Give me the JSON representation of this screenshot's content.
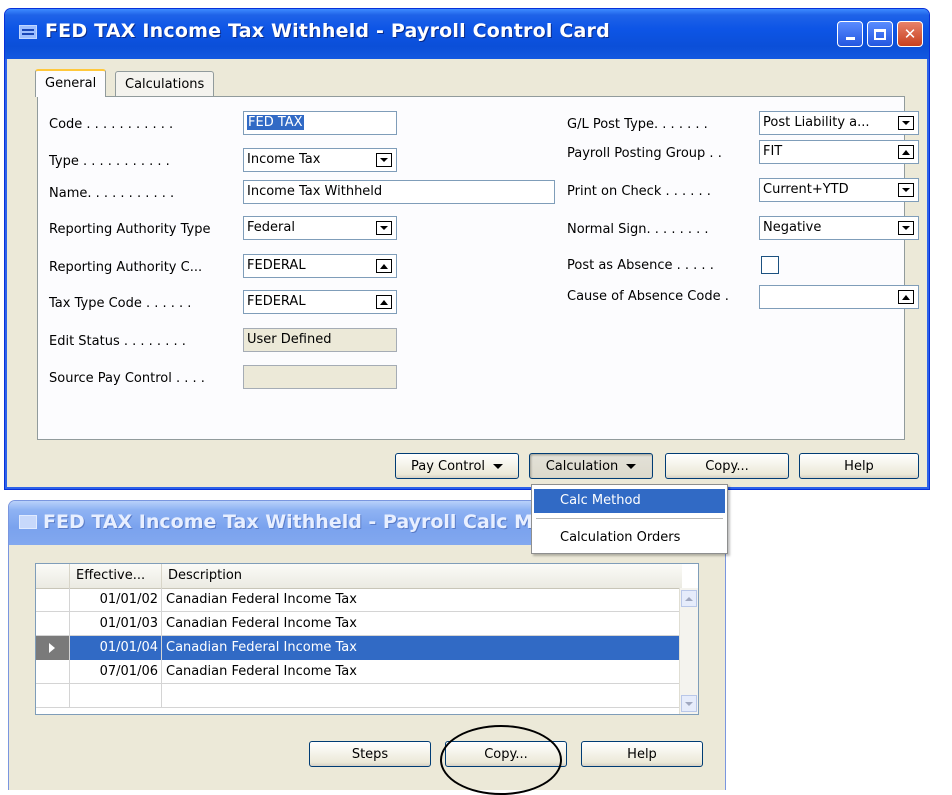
{
  "main_window": {
    "title": "FED TAX Income Tax Withheld - Payroll Control Card",
    "tabs": [
      {
        "label": "General"
      },
      {
        "label": "Calculations"
      }
    ],
    "left_fields": [
      {
        "label": "Code . . . . . . . . . . .",
        "value": "FED TAX"
      },
      {
        "label": "Type . . . . . . . . . . .",
        "value": "Income Tax"
      },
      {
        "label": "Name. . . . . . . . . . .",
        "value": "Income Tax Withheld"
      },
      {
        "label": "Reporting Authority Type",
        "value": "Federal"
      },
      {
        "label": "Reporting Authority C...",
        "value": "FEDERAL"
      },
      {
        "label": "Tax Type Code . . . . . .",
        "value": "FEDERAL"
      },
      {
        "label": "Edit Status . . . . . . . .",
        "value": "User Defined"
      },
      {
        "label": "Source Pay Control . . . .",
        "value": ""
      }
    ],
    "right_fields": [
      {
        "label": "G/L Post Type. . . . . . .",
        "value": "Post Liability a..."
      },
      {
        "label": "Payroll Posting Group . .",
        "value": "FIT"
      },
      {
        "label": "Print on Check . . . . . .",
        "value": "Current+YTD"
      },
      {
        "label": "Normal Sign. . . . . . . .",
        "value": "Negative"
      },
      {
        "label": "Post as Absence . . . . .",
        "value": ""
      },
      {
        "label": "Cause of Absence Code .",
        "value": ""
      }
    ],
    "buttons": {
      "pay_control": "Pay Control",
      "calculation": "Calculation",
      "copy": "Copy...",
      "help": "Help"
    }
  },
  "calculation_menu": {
    "items": [
      {
        "label": "Calc Method",
        "highlighted": true
      },
      {
        "label": "Calculation Orders",
        "highlighted": false
      }
    ]
  },
  "calc_window": {
    "title": "FED TAX Income Tax Withheld - Payroll Calc Method",
    "columns": [
      "Effective...",
      "Description"
    ],
    "rows": [
      {
        "date": "01/01/02",
        "description": "Canadian Federal Income Tax",
        "selected": false
      },
      {
        "date": "01/01/03",
        "description": "Canadian Federal Income Tax",
        "selected": false
      },
      {
        "date": "01/01/04",
        "description": "Canadian Federal Income Tax",
        "selected": true
      },
      {
        "date": "07/01/06",
        "description": "Canadian Federal Income Tax",
        "selected": false
      },
      {
        "date": "",
        "description": "",
        "selected": false
      }
    ],
    "buttons": {
      "steps": "Steps",
      "copy": "Copy...",
      "help": "Help"
    }
  },
  "colors": {
    "title_active": "#0b4fd8",
    "title_inactive": "#7aa2ee",
    "selection": "#316ac5",
    "window_face": "#ece9d8"
  }
}
